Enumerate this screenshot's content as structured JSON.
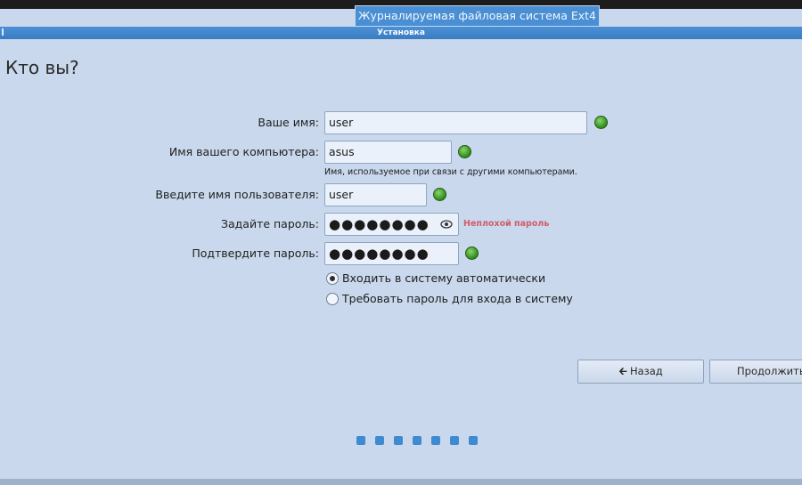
{
  "tooltip": "Журналируемая файловая система Ext4",
  "window": {
    "title": "Установка"
  },
  "page": {
    "title": "Кто вы?"
  },
  "form": {
    "name": {
      "label": "Ваше имя:",
      "value": "user"
    },
    "computer": {
      "label": "Имя вашего компьютера:",
      "value": "asus",
      "hint": "Имя, используемое при связи с другими компьютерами."
    },
    "username": {
      "label": "Введите имя пользователя:",
      "value": "user"
    },
    "password": {
      "label": "Задайте пароль:",
      "value": "●●●●●●●●",
      "strength": "Неплохой пароль"
    },
    "confirm": {
      "label": "Подтвердите пароль:",
      "value": "●●●●●●●●"
    }
  },
  "login_options": {
    "auto": "Входить в систему автоматически",
    "require": "Требовать пароль для входа в систему",
    "selected": "auto"
  },
  "buttons": {
    "back": "Назад",
    "continue": "Продолжить"
  },
  "progress": {
    "steps": 7
  },
  "colors": {
    "background": "#c9d8ec",
    "titlebar": "#4b91d8",
    "ok": "#3d9b25",
    "strength": "#d25a6a"
  }
}
